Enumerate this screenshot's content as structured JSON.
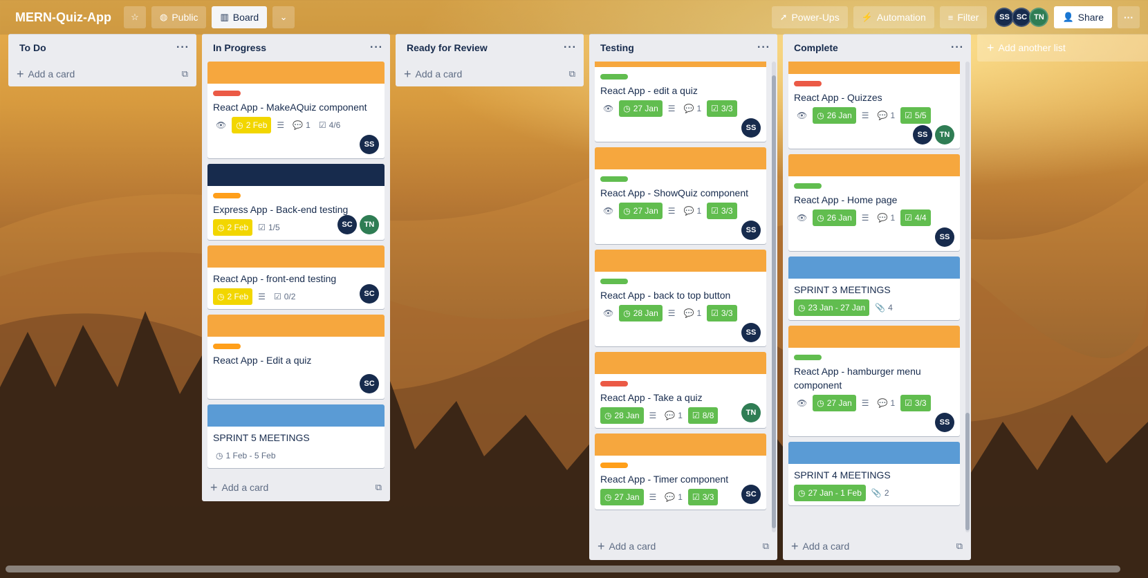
{
  "colors": {
    "orange": "#f6a73e",
    "navy": "#172b4d",
    "blue": "#5a9bd5",
    "label_red": "#eb5a46",
    "label_orange": "#ff9f1a",
    "label_green": "#61bd4f",
    "avatar_ss": "#172b4d",
    "avatar_sc": "#172b4d",
    "avatar_tn": "#2f7d54"
  },
  "header": {
    "title": "MERN-Quiz-App",
    "star_icon": "star-icon",
    "visibility_label": "Public",
    "view_label": "Board",
    "powerups_label": "Power-Ups",
    "automation_label": "Automation",
    "filter_label": "Filter",
    "members": [
      "SS",
      "SC",
      "TN"
    ],
    "share_label": "Share"
  },
  "board": {
    "add_list_label": "Add another list",
    "lists": [
      {
        "title": "To Do",
        "add_label": "Add a card"
      },
      {
        "title": "In Progress",
        "add_label": "Add a card",
        "cards": [
          {
            "title": "React App - MakeAQuiz component",
            "due": "2 Feb",
            "comments": "1",
            "checklist": "4/6",
            "members": [
              "SS"
            ]
          },
          {
            "title": "Express App - Back-end testing",
            "due": "2 Feb",
            "checklist": "1/5",
            "members": [
              "SC",
              "TN"
            ]
          },
          {
            "title": "React App - front-end testing",
            "due": "2 Feb",
            "checklist": "0/2",
            "members": [
              "SC"
            ]
          },
          {
            "title": "React App - Edit a quiz",
            "members": [
              "SC"
            ]
          },
          {
            "title": "SPRINT 5 MEETINGS",
            "dates": "1 Feb - 5 Feb"
          }
        ]
      },
      {
        "title": "Ready for Review",
        "add_label": "Add a card"
      },
      {
        "title": "Testing",
        "add_label": "Add a card",
        "cards": [
          {
            "title": "React App - edit a quiz",
            "due": "27 Jan",
            "comments": "1",
            "checklist": "3/3",
            "members": [
              "SS"
            ]
          },
          {
            "title": "React App - ShowQuiz component",
            "due": "27 Jan",
            "comments": "1",
            "checklist": "3/3",
            "members": [
              "SS"
            ]
          },
          {
            "title": "React App - back to top button",
            "due": "28 Jan",
            "comments": "1",
            "checklist": "3/3",
            "members": [
              "SS"
            ]
          },
          {
            "title": "React App - Take a quiz",
            "due": "28 Jan",
            "comments": "1",
            "checklist": "8/8",
            "members": [
              "TN"
            ]
          },
          {
            "title": "React App - Timer component",
            "due": "27 Jan",
            "comments": "1",
            "checklist": "3/3",
            "members": [
              "SC"
            ]
          }
        ]
      },
      {
        "title": "Complete",
        "add_label": "Add a card",
        "cards": [
          {
            "title": "React App - Quizzes",
            "due": "26 Jan",
            "comments": "1",
            "checklist": "5/5",
            "members": [
              "SS",
              "TN"
            ]
          },
          {
            "title": "React App - Home page",
            "due": "26 Jan",
            "comments": "1",
            "checklist": "4/4",
            "members": [
              "SS"
            ]
          },
          {
            "title": "SPRINT 3 MEETINGS",
            "dates": "23 Jan - 27 Jan",
            "attachments": "4"
          },
          {
            "title": "React App - hamburger menu component",
            "due": "27 Jan",
            "comments": "1",
            "checklist": "3/3",
            "members": [
              "SS"
            ]
          },
          {
            "title": "SPRINT 4 MEETINGS",
            "dates": "27 Jan - 1 Feb",
            "attachments": "2"
          }
        ]
      }
    ]
  }
}
